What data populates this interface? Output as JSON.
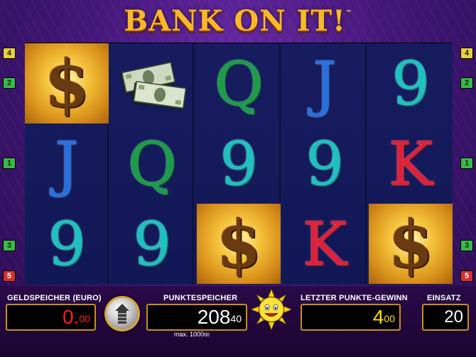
{
  "game": {
    "title": "BANK ON IT!",
    "trademark": "™"
  },
  "row_markers": {
    "left": [
      "4",
      "2",
      "1",
      "3",
      "5"
    ],
    "right": [
      "4",
      "2",
      "1",
      "3",
      "5"
    ]
  },
  "reels": [
    [
      "dollar",
      "J",
      "9"
    ],
    [
      "money-stack",
      "Q",
      "9"
    ],
    [
      "Q",
      "9",
      "dollar"
    ],
    [
      "J",
      "9",
      "K"
    ],
    [
      "9",
      "K",
      "dollar"
    ]
  ],
  "symbols": {
    "J": "J",
    "Q": "Q",
    "K": "K",
    "nine": "9",
    "dollar": "$"
  },
  "panel": {
    "credit_label": "GELDSPEICHER (EURO)",
    "credit_main": "0.",
    "credit_cents": "00",
    "points_label": "PUNKTESPEICHER",
    "points_main": "208",
    "points_small": "40",
    "points_max": "max. 1000",
    "points_max_small": "00",
    "last_win_label": "LETZTER PUNKTE-GEWINN",
    "last_win_main": "4",
    "last_win_small": "00",
    "bet_label": "EINSATZ",
    "bet_value": "20"
  },
  "colors": {
    "credit_text": "#ff2020",
    "points_text": "#ffffff",
    "win_text": "#ffe000",
    "bet_text": "#ffffff",
    "box_border": "#c98f1a"
  },
  "icons": {
    "gamble": "risk-ladder-icon",
    "mascot": "sun-mascot-icon"
  }
}
